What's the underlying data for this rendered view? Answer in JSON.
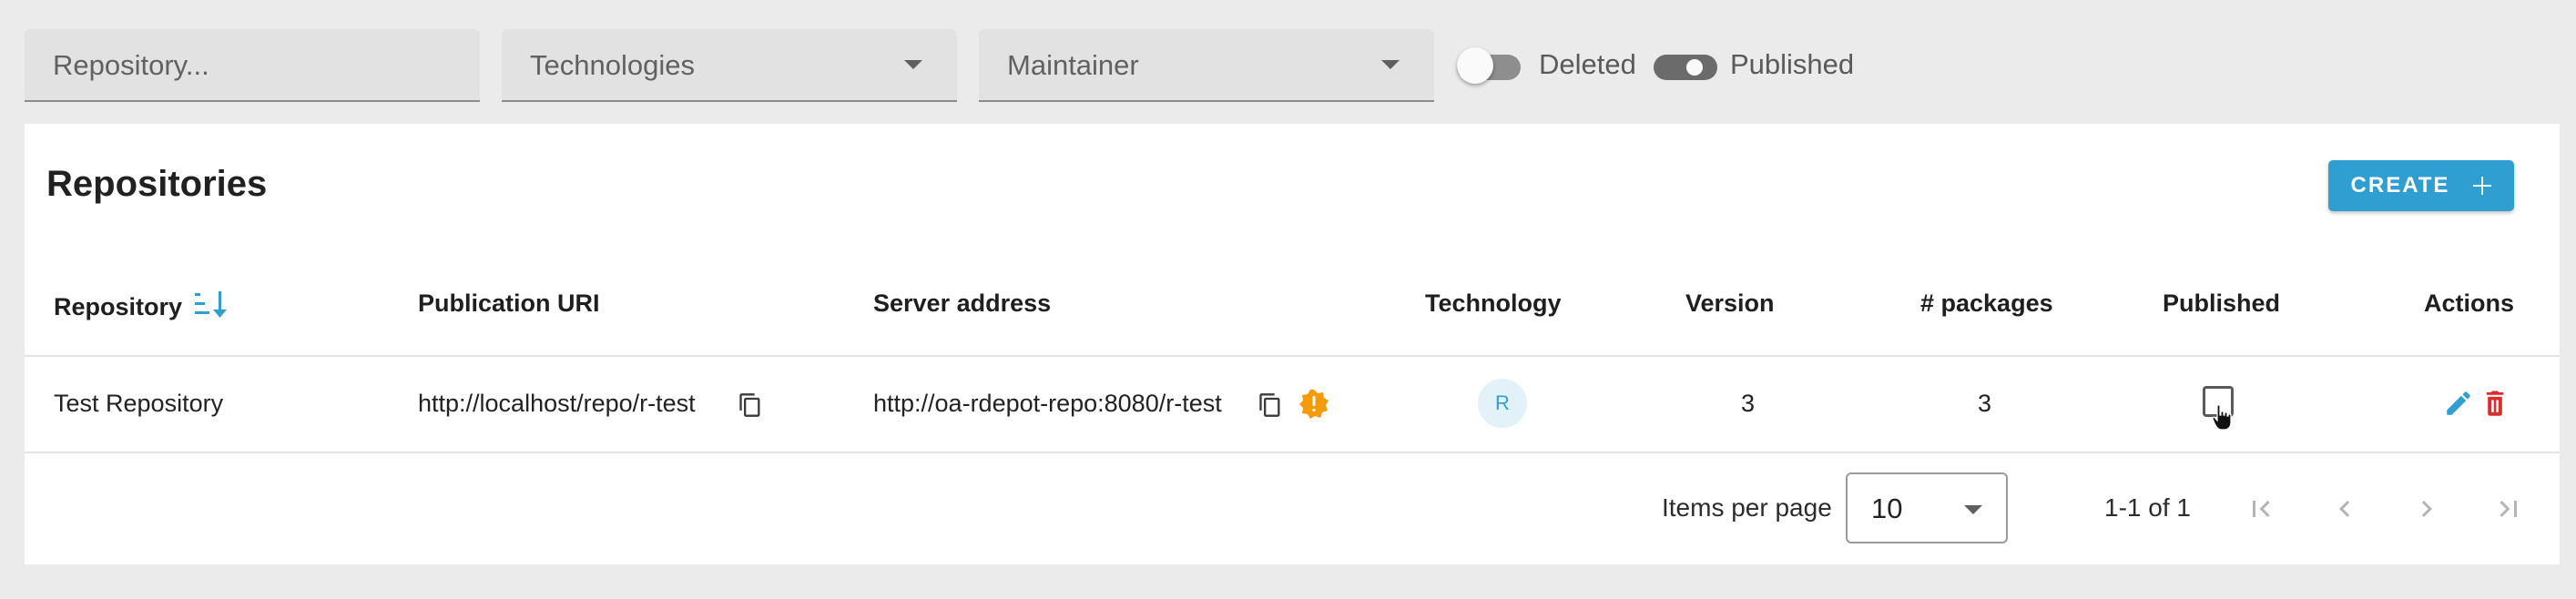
{
  "filters": {
    "repository_placeholder": "Repository...",
    "technologies_placeholder": "Technologies",
    "maintainer_placeholder": "Maintainer",
    "deleted_label": "Deleted",
    "deleted_on": false,
    "published_label": "Published",
    "published_on": true
  },
  "card": {
    "title": "Repositories",
    "create_label": "CREATE"
  },
  "table": {
    "columns": [
      "Repository",
      "Publication URI",
      "Server address",
      "Technology",
      "Version",
      "# packages",
      "Published",
      "Actions"
    ],
    "rows": [
      {
        "repository": "Test Repository",
        "publication_uri": "http://localhost/repo/r-test",
        "server_address": "http://oa-rdepot-repo:8080/r-test",
        "technology": "R",
        "version": "3",
        "packages": "3",
        "published": false
      }
    ]
  },
  "pagination": {
    "items_per_page_label": "Items per page",
    "items_per_page_value": "10",
    "range_text": "1-1 of 1"
  },
  "colors": {
    "accent": "#2f9fd2",
    "warning": "#f59b0b",
    "delete": "#e02b2b",
    "tech_badge_bg": "#e3f2f8"
  },
  "icons": [
    "sort-icon",
    "copy-icon",
    "warning-icon",
    "edit-icon",
    "delete-icon",
    "plus-icon",
    "first-page-icon",
    "previous-page-icon",
    "next-page-icon",
    "last-page-icon",
    "cursor-pointer-icon"
  ]
}
